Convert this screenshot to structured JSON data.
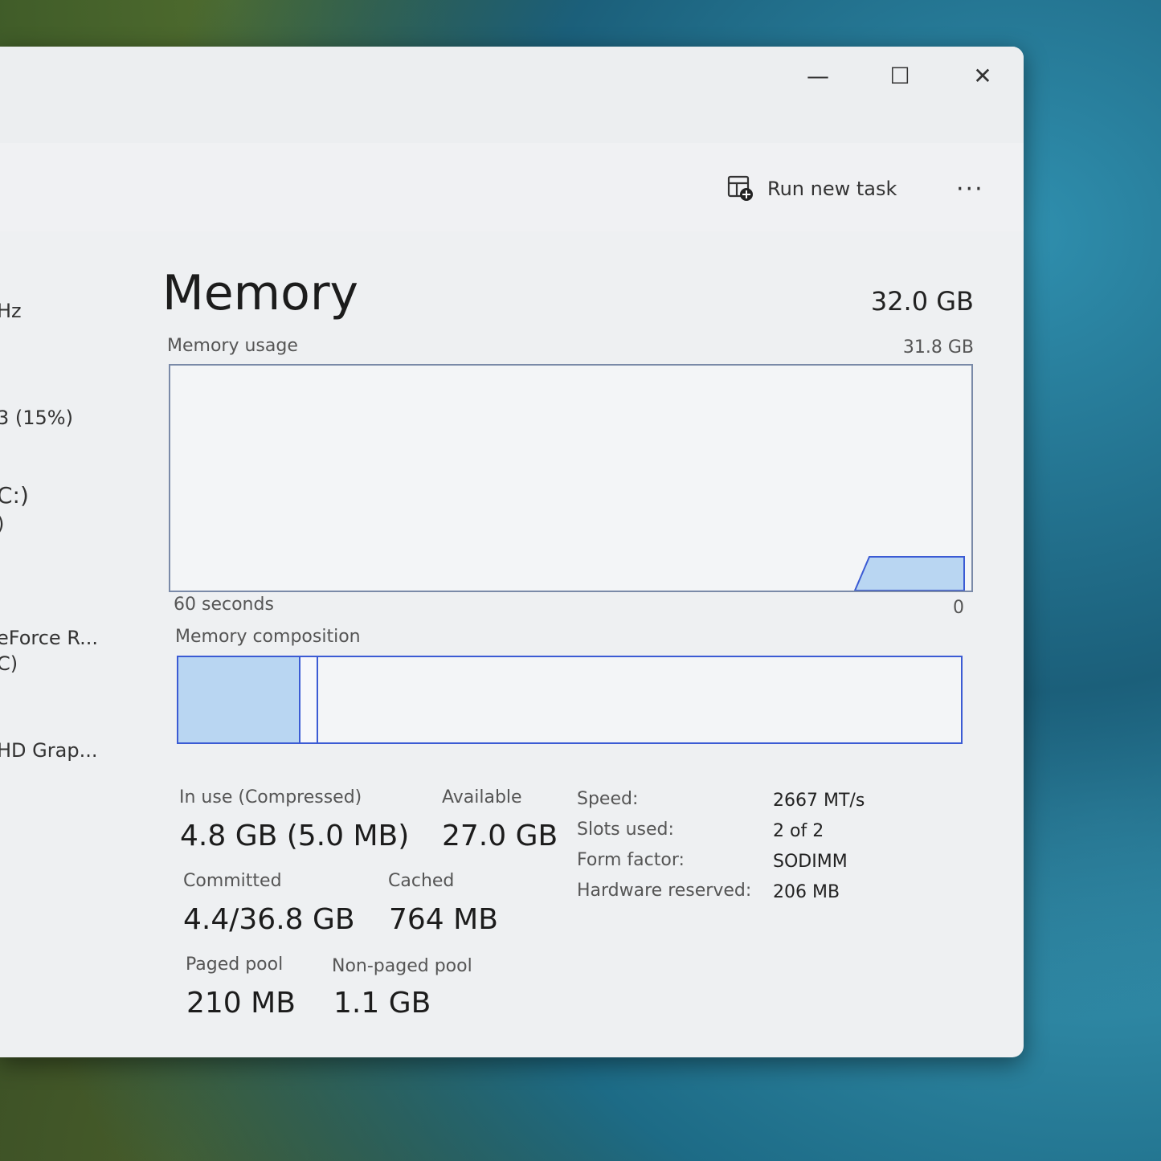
{
  "window": {
    "minimize_glyph": "—",
    "maximize_glyph": "☐",
    "close_glyph": "✕"
  },
  "toolbar": {
    "run_new_task": "Run new task",
    "more_glyph": "···",
    "run_icon": "run-task-icon"
  },
  "sidebar": {
    "fragments": [
      "Hz",
      "3 (15%)",
      "C:)",
      ")",
      "eForce R...",
      "C)",
      "HD Grap..."
    ]
  },
  "memory": {
    "title": "Memory",
    "total": "32.0 GB",
    "usage_label": "Memory usage",
    "usage_max": "31.8 GB",
    "time_label": "60 seconds",
    "time_end": "0",
    "composition_label": "Memory composition"
  },
  "stats": {
    "in_use_label": "In use (Compressed)",
    "in_use_value": "4.8 GB (5.0 MB)",
    "available_label": "Available",
    "available_value": "27.0 GB",
    "committed_label": "Committed",
    "committed_value": "4.4/36.8 GB",
    "cached_label": "Cached",
    "cached_value": "764 MB",
    "paged_pool_label": "Paged pool",
    "paged_pool_value": "210 MB",
    "non_paged_pool_label": "Non-paged pool",
    "non_paged_pool_value": "1.1 GB"
  },
  "details": {
    "speed_label": "Speed:",
    "speed_value": "2667 MT/s",
    "slots_label": "Slots used:",
    "slots_value": "2 of 2",
    "form_label": "Form factor:",
    "form_value": "SODIMM",
    "reserved_label": "Hardware reserved:",
    "reserved_value": "206 MB"
  },
  "colors": {
    "accent": "#3b5bd4",
    "fill": "#b9d6f2"
  }
}
